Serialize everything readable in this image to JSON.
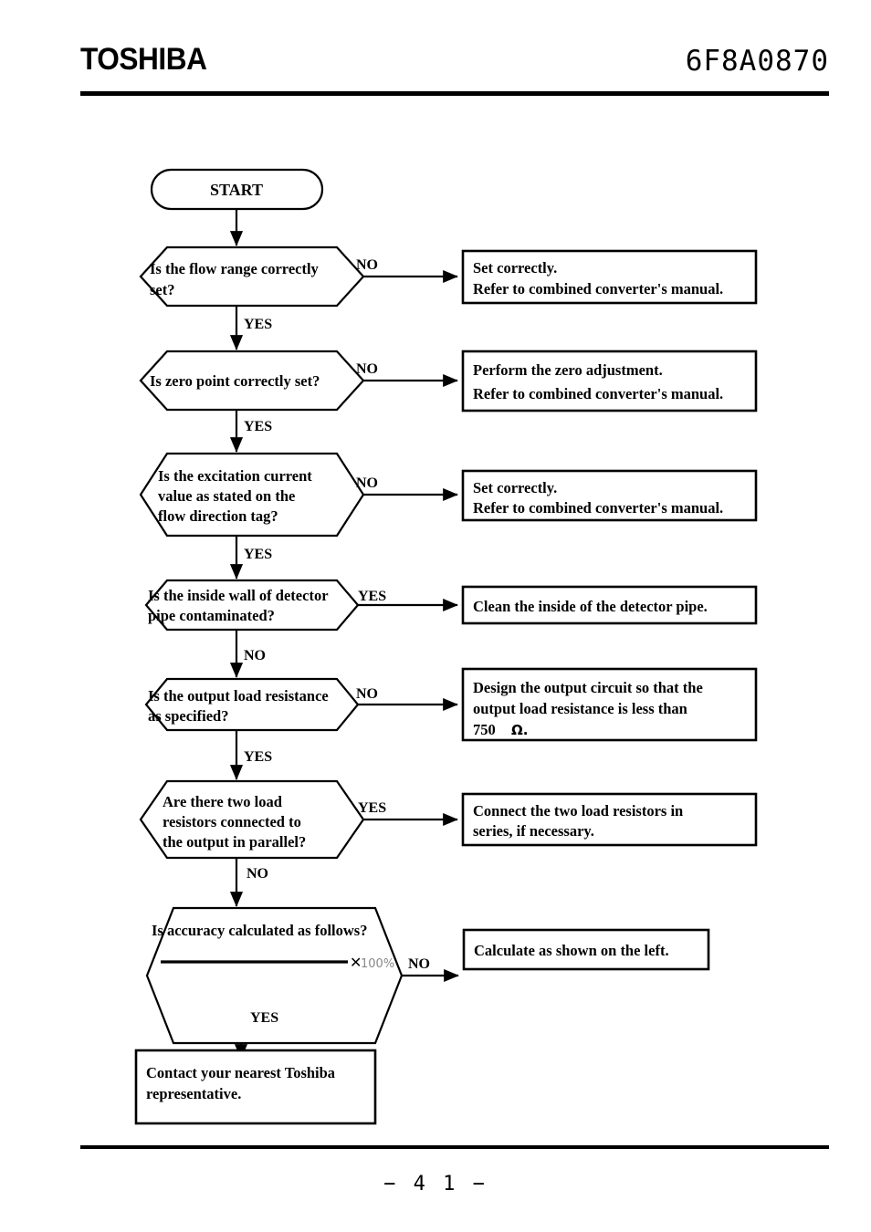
{
  "header": {
    "brand": "TOSHIBA",
    "document_number": "6F8A0870"
  },
  "footer": {
    "page_number": "−  4 1  −"
  },
  "flowchart": {
    "start_label": "START",
    "branch_labels": {
      "yes": "YES",
      "no": "NO"
    },
    "nodes": [
      {
        "id": "flow-range",
        "type": "decision",
        "lines": [
          "Is the flow range correctly",
          "set?"
        ],
        "branch_out_side": "NO",
        "branch_down": "YES"
      },
      {
        "id": "zero-point",
        "type": "decision",
        "lines": [
          "Is zero point correctly set?"
        ],
        "branch_out_side": "NO",
        "branch_down": "YES"
      },
      {
        "id": "excitation-current",
        "type": "decision",
        "lines": [
          "Is the excitation current",
          "value as stated on the",
          "flow direction tag?"
        ],
        "branch_out_side": "NO",
        "branch_down": "YES"
      },
      {
        "id": "pipe-contamination",
        "type": "decision",
        "lines": [
          "Is the inside wall of detector",
          "pipe contaminated?"
        ],
        "branch_out_side": "YES",
        "branch_down": "NO"
      },
      {
        "id": "load-resistance",
        "type": "decision",
        "lines": [
          "Is the output load resistance",
          "as specified?"
        ],
        "branch_out_side": "NO",
        "branch_down": "YES"
      },
      {
        "id": "parallel-resistors",
        "type": "decision",
        "lines": [
          "Are there two load",
          "resistors connected to",
          "the output in parallel?"
        ],
        "branch_out_side": "YES",
        "branch_down": "NO"
      },
      {
        "id": "accuracy-formula",
        "type": "decision",
        "lines": [
          "Is accuracy calculated as follows?"
        ],
        "formula": {
          "multiply_symbol": "✕",
          "percent": "100%"
        },
        "branch_out_side": "NO",
        "branch_down": "YES"
      }
    ],
    "actions": [
      {
        "id": "action-set-correctly-range",
        "lines": [
          "Set correctly.",
          "Refer to combined converter's manual."
        ]
      },
      {
        "id": "action-zero-adjustment",
        "lines": [
          "Perform the zero adjustment.",
          "Refer to combined converter's manual."
        ]
      },
      {
        "id": "action-set-correctly-excitation",
        "lines": [
          "Set correctly.",
          "Refer to combined converter's manual."
        ]
      },
      {
        "id": "action-clean-pipe",
        "lines": [
          "Clean the inside of the detector pipe."
        ]
      },
      {
        "id": "action-design-circuit",
        "lines": [
          "Design  the  output  circuit  so  that  the",
          "output load resistance is less than",
          "750"
        ],
        "ohm_symbol": "Ω."
      },
      {
        "id": "action-series-resistors",
        "lines": [
          "Connect  the  two  load  resistors  in",
          "series, if necessary."
        ]
      },
      {
        "id": "action-calculate",
        "lines": [
          "Calculate as shown on the left."
        ]
      }
    ],
    "terminal": {
      "id": "contact-toshiba",
      "lines": [
        "Contact  your  nearest  Toshiba",
        "representative."
      ]
    }
  }
}
